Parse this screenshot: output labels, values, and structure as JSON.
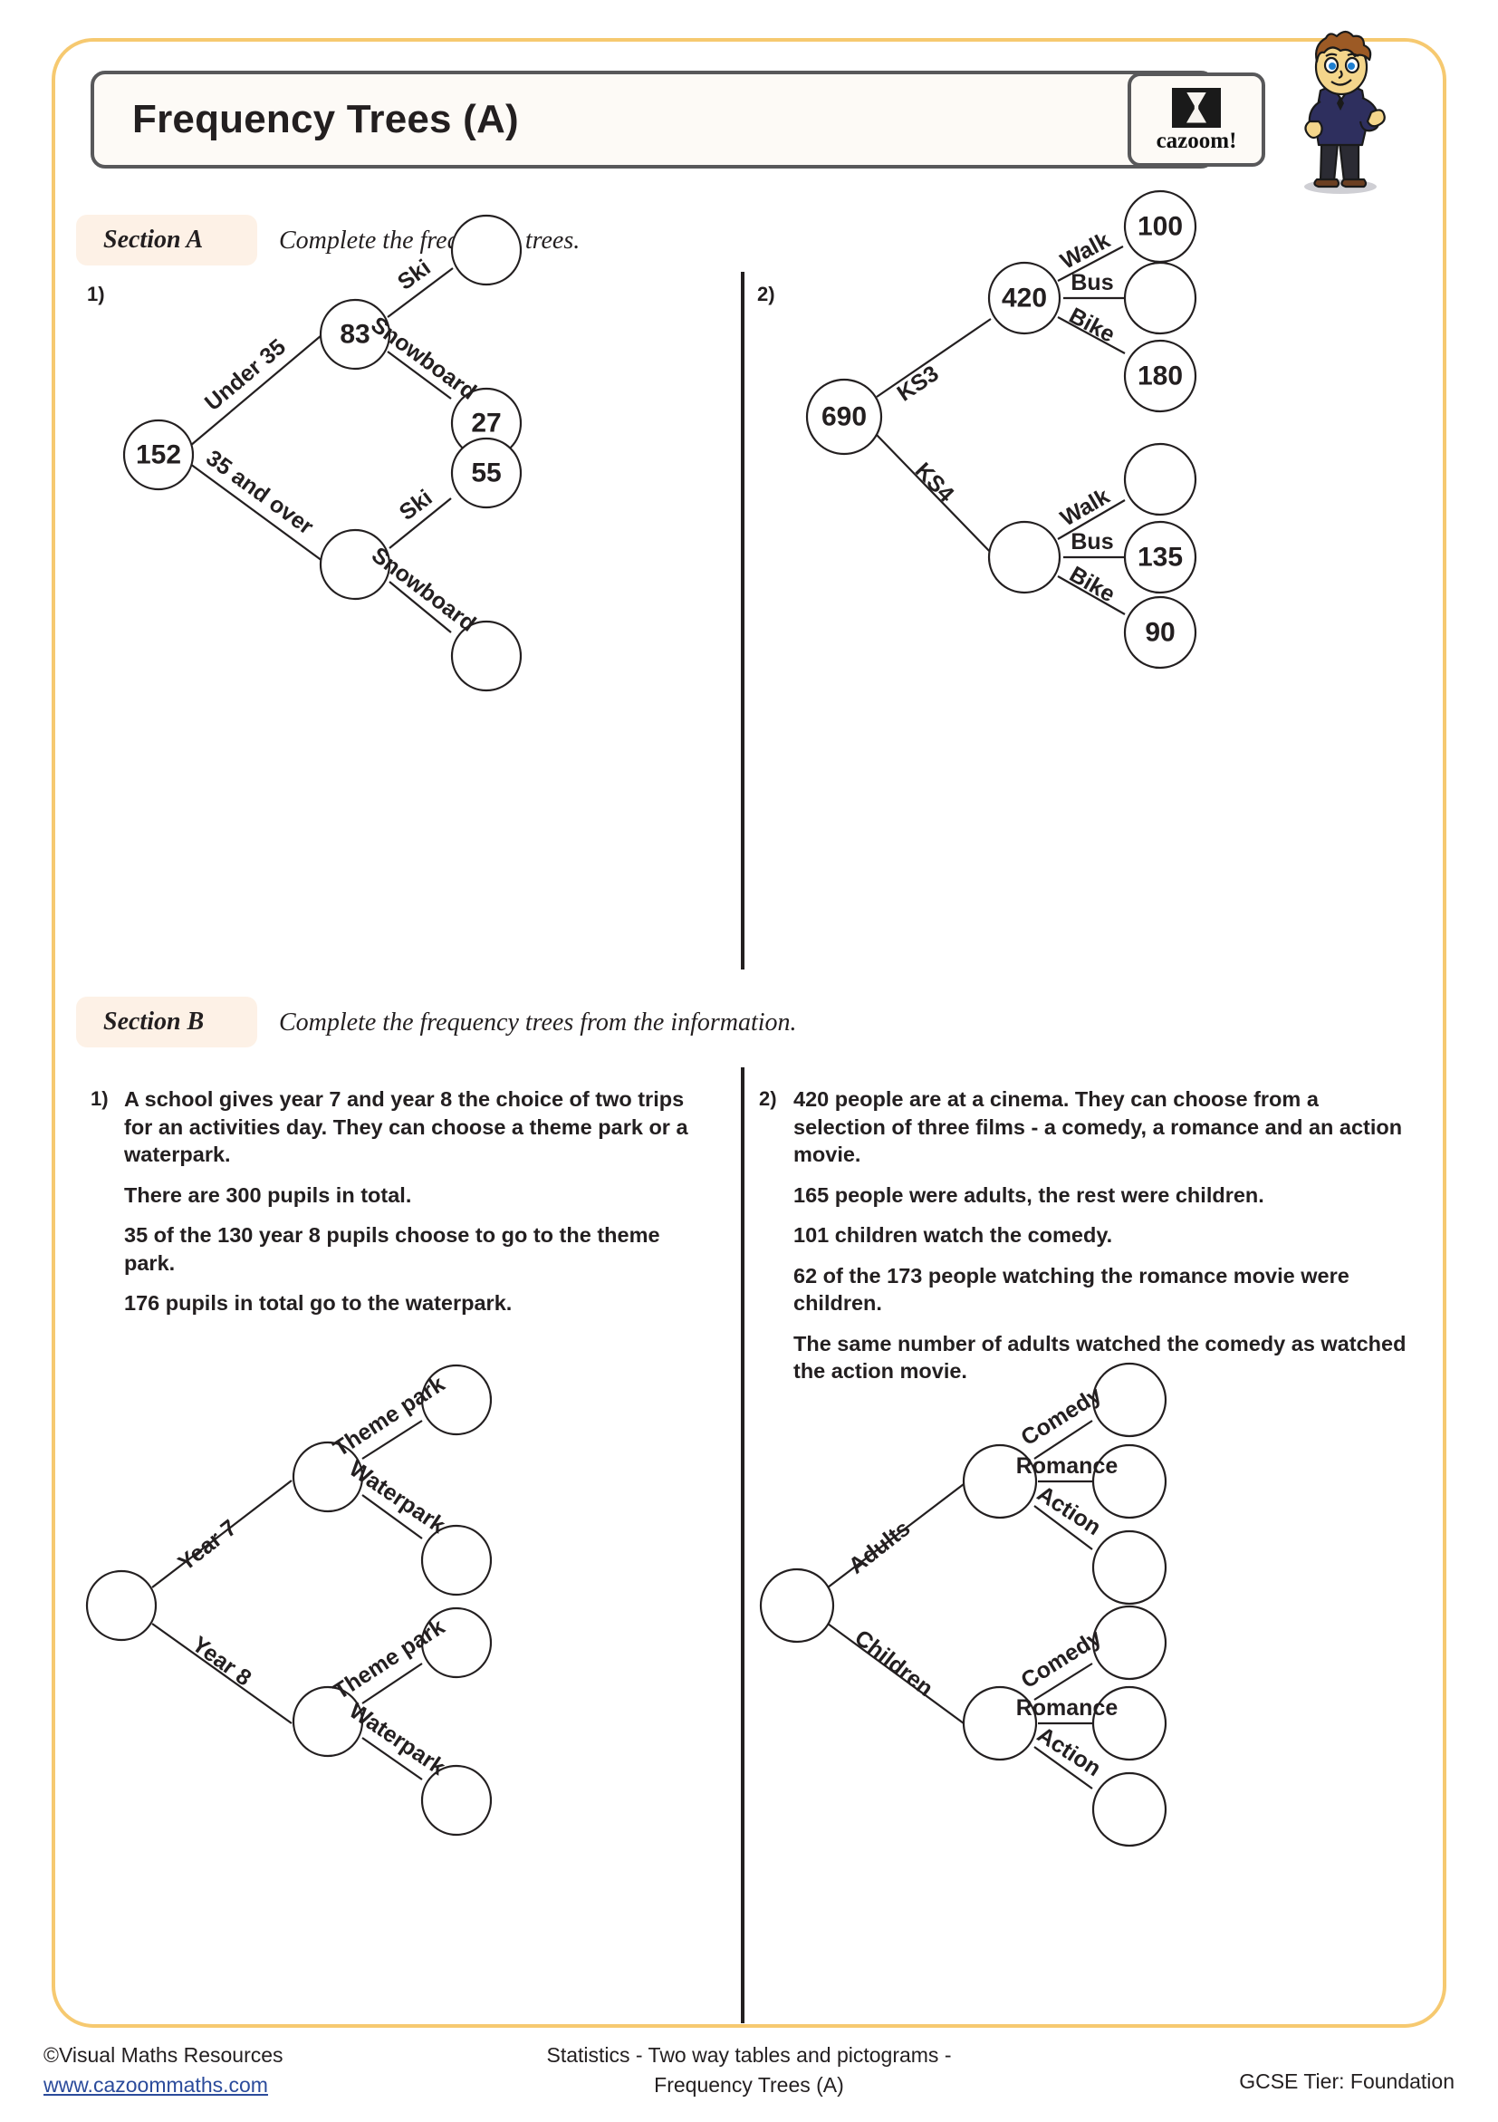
{
  "header": {
    "title": "Frequency Trees (A)",
    "logo_word": "cazoom!",
    "logo_mark_name": "hourglass-icon"
  },
  "sections": {
    "a": {
      "label": "Section A",
      "instruction": "Complete the frequency trees."
    },
    "b": {
      "label": "Section B",
      "instruction": "Complete the frequency trees from the information."
    }
  },
  "section_a": {
    "q1": {
      "number": "1)",
      "root": "152",
      "branch1_label": "Under 35",
      "branch1_node": "83",
      "branch1_leaf1_label": "Ski",
      "branch1_leaf1_value": "",
      "branch1_leaf2_label": "Snowboard",
      "branch1_leaf2_value": "27",
      "branch2_label": "35 and over",
      "branch2_node": "",
      "branch2_leaf1_label": "Ski",
      "branch2_leaf1_value": "55",
      "branch2_leaf2_label": "Snowboard",
      "branch2_leaf2_value": ""
    },
    "q2": {
      "number": "2)",
      "root": "690",
      "branch1_label": "KS3",
      "branch1_node": "420",
      "branch1_leaf1_label": "Walk",
      "branch1_leaf1_value": "100",
      "branch1_leaf2_label": "Bus",
      "branch1_leaf2_value": "",
      "branch1_leaf3_label": "Bike",
      "branch1_leaf3_value": "180",
      "branch2_label": "KS4",
      "branch2_node": "",
      "branch2_leaf1_label": "Walk",
      "branch2_leaf1_value": "",
      "branch2_leaf2_label": "Bus",
      "branch2_leaf2_value": "135",
      "branch2_leaf3_label": "Bike",
      "branch2_leaf3_value": "90"
    }
  },
  "section_b": {
    "q1": {
      "number": "1)",
      "para1": "A school gives year 7 and year 8 the choice of two trips for an activities day. They can choose a theme park or a waterpark.",
      "para2": "There are 300 pupils in total.",
      "para3": "35 of the 130 year 8 pupils choose to go to the theme park.",
      "para4": "176 pupils in total go to the waterpark.",
      "root": "",
      "branch1_label": "Year 7",
      "branch1_node": "",
      "branch1_leaf1_label": "Theme park",
      "branch1_leaf1_value": "",
      "branch1_leaf2_label": "Waterpark",
      "branch1_leaf2_value": "",
      "branch2_label": "Year 8",
      "branch2_node": "",
      "branch2_leaf1_label": "Theme park",
      "branch2_leaf1_value": "",
      "branch2_leaf2_label": "Waterpark",
      "branch2_leaf2_value": ""
    },
    "q2": {
      "number": "2)",
      "para1": "420 people are at a cinema. They can choose from a selection of three films - a comedy, a romance and an action movie.",
      "para2": "165 people were adults, the rest were children.",
      "para3": "101 children watch the comedy.",
      "para4": "62 of the 173 people watching the romance movie were children.",
      "para5": "The same number of adults watched the comedy as watched the action movie.",
      "root": "",
      "branch1_label": "Adults",
      "branch1_node": "",
      "branch1_leaf1_label": "Comedy",
      "branch1_leaf1_value": "",
      "branch1_leaf2_label": "Romance",
      "branch1_leaf2_value": "",
      "branch1_leaf3_label": "Action",
      "branch1_leaf3_value": "",
      "branch2_label": "Children",
      "branch2_node": "",
      "branch2_leaf1_label": "Comedy",
      "branch2_leaf1_value": "",
      "branch2_leaf2_label": "Romance",
      "branch2_leaf2_value": "",
      "branch2_leaf3_label": "Action",
      "branch2_leaf3_value": ""
    }
  },
  "footer": {
    "copyright": "©Visual Maths Resources",
    "website": "www.cazoommaths.com",
    "topic_line1": "Statistics - Two way tables and pictograms -",
    "topic_line2": "Frequency Trees (A)",
    "tier": "GCSE Tier: Foundation"
  },
  "colors": {
    "frame": "#f6c970",
    "chip": "#fdf1e6",
    "ink": "#231f20",
    "link": "#2b4b9b"
  }
}
